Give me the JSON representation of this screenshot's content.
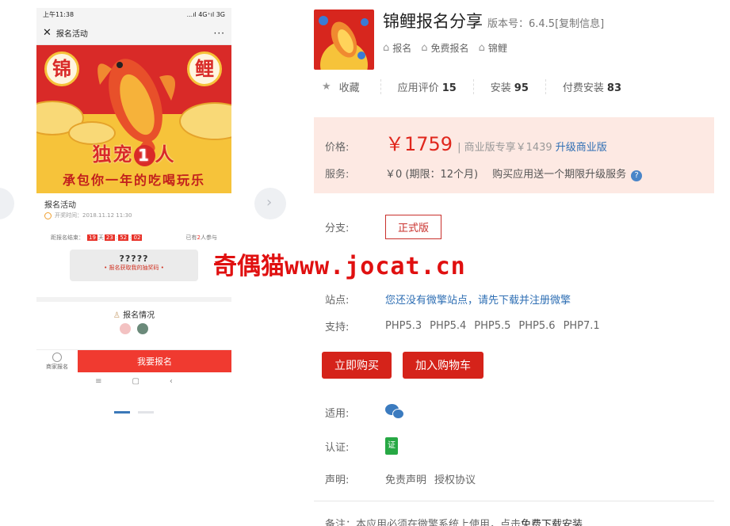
{
  "phone_preview": {
    "status_time": "上午11:38",
    "status_signal": "...ıl 4G⁺ıl 3G",
    "page_title": "报名活动",
    "more_label": "···",
    "poster_left_char": "锦",
    "poster_right_char": "鲤",
    "poster_headline_a": "独宠",
    "poster_headline_one": "1",
    "poster_headline_b": "人",
    "poster_subline": "承包你一年的吃喝玩乐",
    "activity_title": "报名活动",
    "activity_time": "开奖时间：2018.11.12 11:30",
    "countdown_label": "距报名结束：",
    "countdown": {
      "d": "19",
      "d_unit": "天",
      "h": "23",
      "m": "52",
      "s": "02"
    },
    "participants_prefix": "已有",
    "participants_count": "2",
    "participants_suffix": "人参与",
    "ticket_code": "?????",
    "ticket_note": "• 报名获取我的抽奖码 •",
    "signups_title": "报名情况",
    "home_label": "商家报名",
    "signup_button": "我要报名",
    "sys_nav": [
      "≡",
      "▢",
      "‹"
    ]
  },
  "app": {
    "name": "锦鲤报名分享",
    "version_label": "版本号：6.4.5[复制信息]",
    "tags": [
      "报名",
      "免费报名",
      "锦鲤"
    ]
  },
  "stats": {
    "favorite_label": "收藏",
    "reviews_label": "应用评价",
    "reviews_count": "15",
    "installs_label": "安装",
    "installs_count": "95",
    "paid_label": "付费安装",
    "paid_count": "83"
  },
  "price": {
    "label": "价格:",
    "value": "￥1759",
    "business_text": "| 商业版专享￥1439",
    "upgrade_link": "升级商业版",
    "service_label": "服务:",
    "service_value": "￥0 (期限：12个月)",
    "service_note": "购买应用送一个期限升级服务",
    "help_icon": "?"
  },
  "details": {
    "branch_label": "分支:",
    "branch_value": "正式版",
    "site_label": "站点:",
    "site_value": "您还没有微擎站点，请先下载并注册微擎",
    "support_label": "支持:",
    "php_versions": [
      "PHP5.3",
      "PHP5.4",
      "PHP5.5",
      "PHP5.6",
      "PHP7.1"
    ],
    "buy_button": "立即购买",
    "cart_button": "加入购物车",
    "platform_label": "适用:",
    "cert_label": "认证:",
    "statement_label": "声明:",
    "disclaimer_link": "免责声明",
    "license_link": "授权协议",
    "note_text": "备注：本应用必须在微擎系统上使用，点击",
    "note_link": "免费下载安装"
  },
  "watermark": {
    "cn": "奇偶猫",
    "url": "www.jocat.cn"
  },
  "colors": {
    "accent_red": "#d5231a",
    "price_red": "#e0271d",
    "link_blue": "#2f6fb4",
    "price_bg": "#fde9e3"
  }
}
